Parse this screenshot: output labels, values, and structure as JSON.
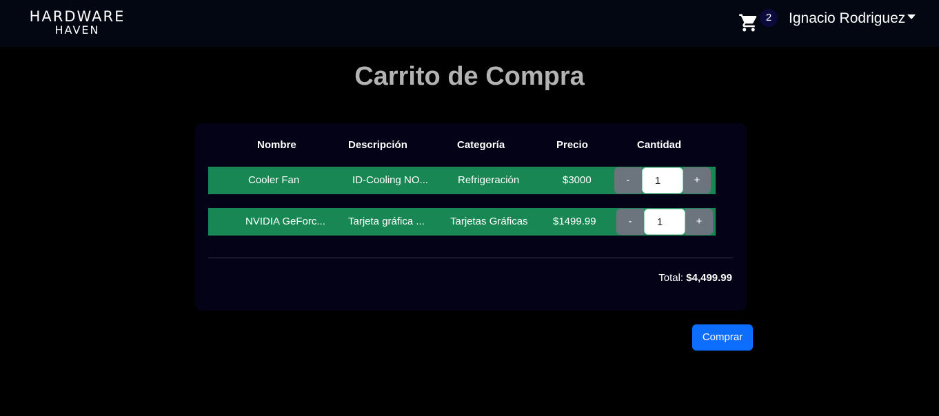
{
  "navbar": {
    "logo_line1": "HARDWARE",
    "logo_line2": "HAVEN",
    "cart_icon": "shopping-cart-icon",
    "cart_count": "2",
    "user_name": "Ignacio Rodriguez"
  },
  "page": {
    "title": "Carrito de Compra"
  },
  "table": {
    "headers": [
      "Nombre",
      "Descripción",
      "Categoría",
      "Precio",
      "Cantidad"
    ],
    "rows": [
      {
        "nombre": "Cooler Fan",
        "descripcion": "ID-Cooling NO...",
        "categoria": "Refrigeración",
        "precio": "$3000",
        "minus_label": "-",
        "cantidad": "1",
        "plus_label": "+"
      },
      {
        "nombre": "NVIDIA GeForc...",
        "descripcion": "Tarjeta gráfica ...",
        "categoria": "Tarjetas Gráficas",
        "precio": "$1499.99",
        "minus_label": "-",
        "cantidad": "1",
        "plus_label": "+"
      }
    ]
  },
  "summary": {
    "total_label": "Total:",
    "total_value": "$4,499.99"
  },
  "actions": {
    "buy_label": "Comprar"
  },
  "colors": {
    "row_bg": "#198754",
    "primary": "#0d6efd",
    "secondary": "#6c757d",
    "card_bg": "#030217",
    "navbar_bg": "#030711"
  }
}
